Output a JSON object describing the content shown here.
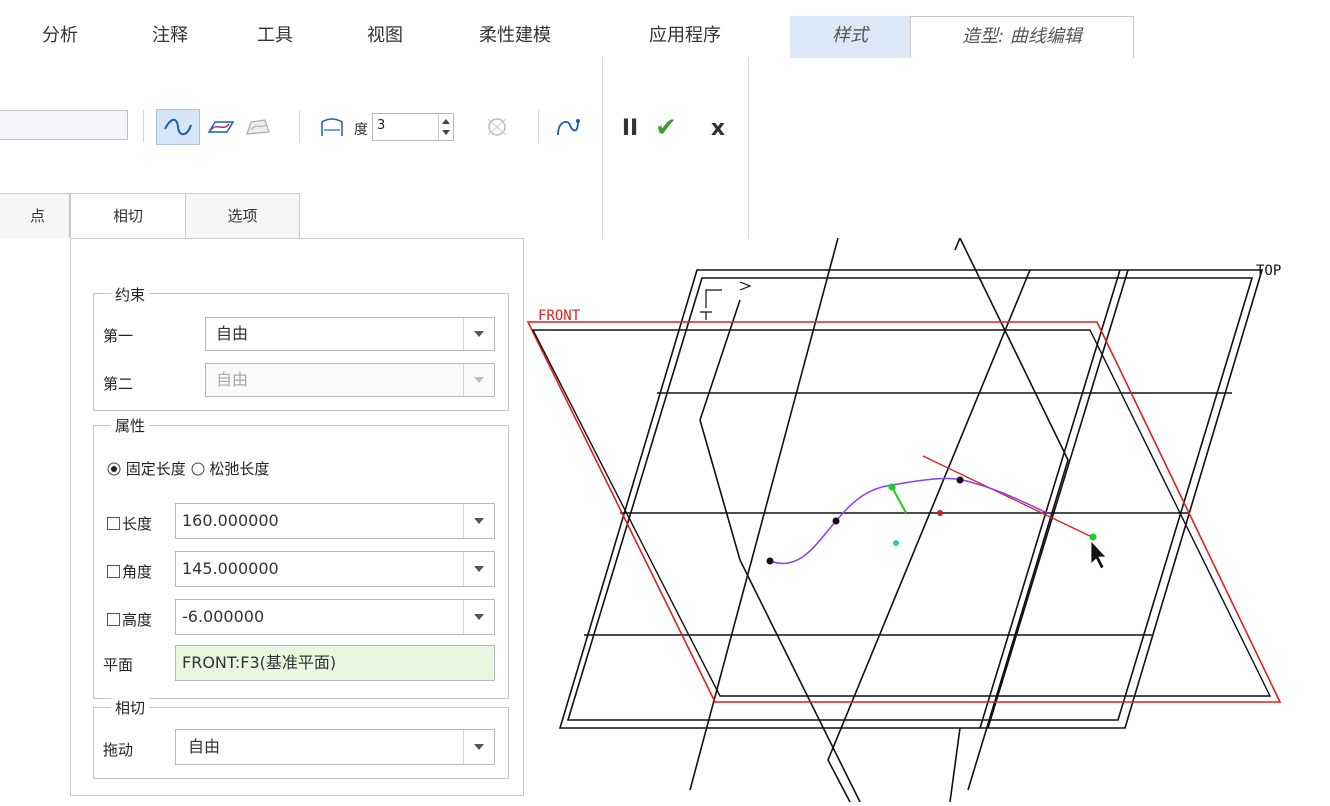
{
  "tabs": [
    {
      "label": "分析"
    },
    {
      "label": "注释"
    },
    {
      "label": "工具"
    },
    {
      "label": "视图"
    },
    {
      "label": "柔性建模"
    },
    {
      "label": "应用程序"
    },
    {
      "label": "样式"
    },
    {
      "label": "造型: 曲线编辑"
    }
  ],
  "ribbon": {
    "degree_label": "度",
    "degree_value": "3",
    "pause_label": "II",
    "ok_label": "✔",
    "cancel_label": "x"
  },
  "subtabs": [
    {
      "label": "点"
    },
    {
      "label": "相切"
    },
    {
      "label": "选项"
    }
  ],
  "panel": {
    "constraints": {
      "title": "约束",
      "first_label": "第一",
      "first_value": "自由",
      "second_label": "第二",
      "second_value": "自由"
    },
    "properties": {
      "title": "属性",
      "fixed_length": "固定长度",
      "relaxed_length": "松弛长度",
      "length_label": "长度",
      "length_value": "160.000000",
      "angle_label": "角度",
      "angle_value": "145.000000",
      "height_label": "高度",
      "height_value": "-6.000000",
      "plane_label": "平面",
      "plane_value": "FRONT:F3(基准平面)"
    },
    "tangent": {
      "title": "相切",
      "drag_label": "拖动",
      "drag_value": "自由"
    }
  },
  "viewport": {
    "front_label": "FRONT",
    "top_label": "TOP"
  },
  "colors": {
    "datum_red": "#e02020",
    "curve_purple": "#8a3cff",
    "control_green": "#22cc22",
    "control_cyan": "#22cccc",
    "style_tab_bg": "#dbe8f7",
    "plane_field_bg": "#e8f8e0"
  }
}
